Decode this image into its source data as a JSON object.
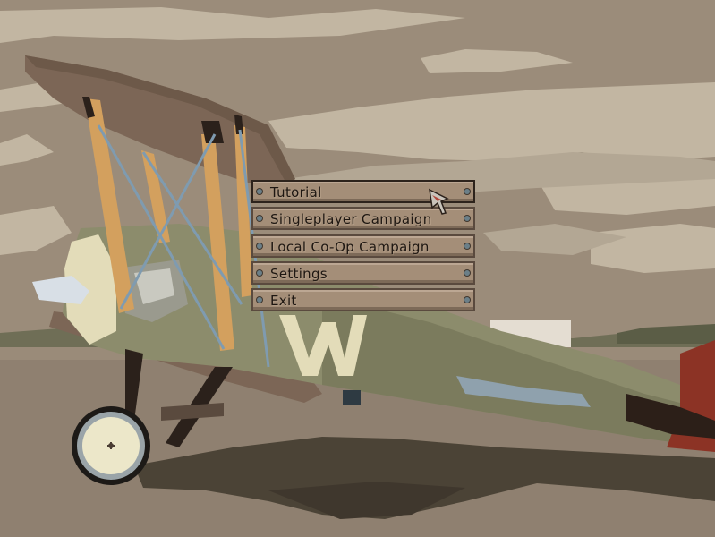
{
  "menu": {
    "items": [
      {
        "label": "Tutorial",
        "selected": true
      },
      {
        "label": "Singleplayer Campaign",
        "selected": false
      },
      {
        "label": "Local Co-Op Campaign",
        "selected": false
      },
      {
        "label": "Settings",
        "selected": false
      },
      {
        "label": "Exit",
        "selected": false
      }
    ]
  },
  "cursor": {
    "icon": "arrow-cursor-icon"
  },
  "scene": {
    "icons": [
      "biplane-icon"
    ],
    "aircraft_marking": "W",
    "colors": {
      "sky": "#9b8c7a",
      "clouds": "#c2b6a2",
      "ground": "#8f8070",
      "fuselage": "#8c8c6c",
      "wing": "#7c6656",
      "strut": "#d3a05e",
      "marking": "#e3dcb9",
      "rudder": "#8c3325"
    }
  }
}
